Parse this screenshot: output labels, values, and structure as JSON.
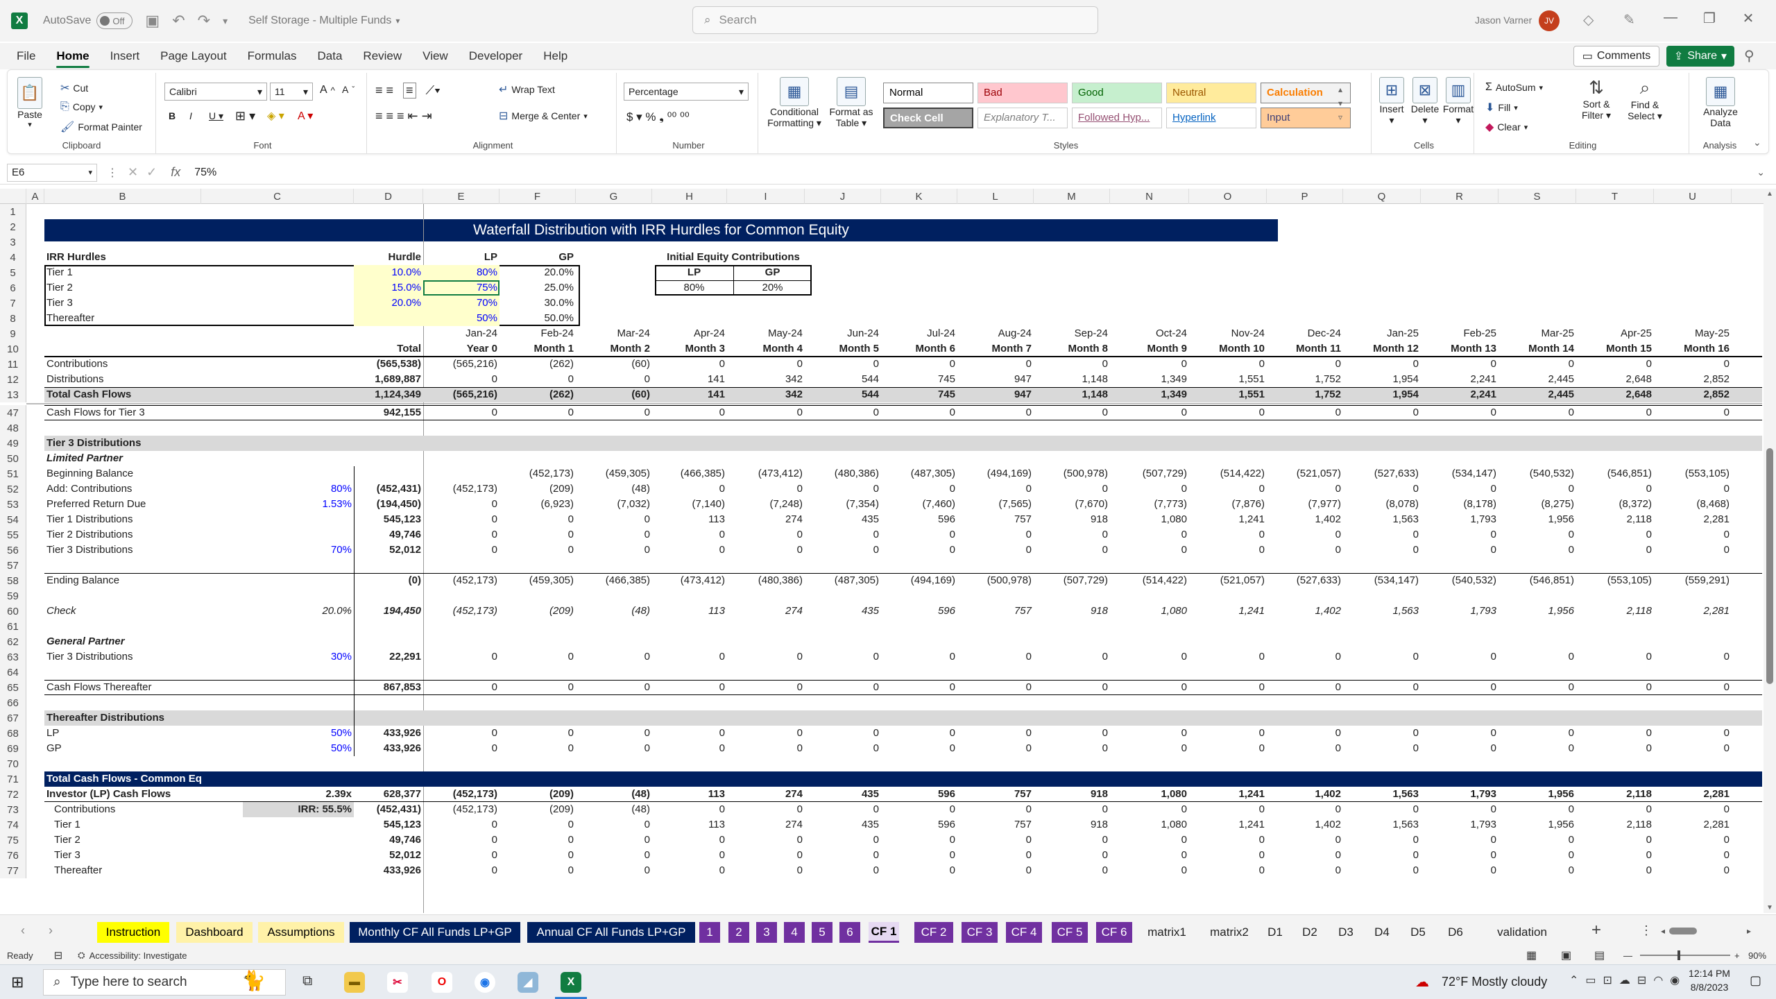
{
  "window": {
    "autosave": "AutoSave",
    "autosave_state": "Off",
    "filename": "Self Storage - Multiple Funds",
    "search_placeholder": "Search",
    "user": "Jason Varner",
    "user_initials": "JV"
  },
  "menu": [
    "File",
    "Home",
    "Insert",
    "Page Layout",
    "Formulas",
    "Data",
    "Review",
    "View",
    "Developer",
    "Help"
  ],
  "comments": "Comments",
  "share": "Share",
  "ribbon": {
    "paste": "Paste",
    "cut": "Cut",
    "copy": "Copy",
    "format_painter": "Format Painter",
    "clipboard": "Clipboard",
    "font_name": "Calibri",
    "font_size": "11",
    "font": "Font",
    "wrap_text": "Wrap Text",
    "merge_center": "Merge & Center",
    "alignment": "Alignment",
    "number_format": "Percentage",
    "number": "Number",
    "conditional": "Conditional",
    "formatting": "Formatting",
    "format_as": "Format as",
    "table": "Table",
    "styles": "Styles",
    "cells": "Cells",
    "insert": "Insert",
    "delete": "Delete",
    "format": "Format",
    "autosum": "AutoSum",
    "fill": "Fill",
    "clear": "Clear",
    "sort": "Sort &",
    "filter": "Filter",
    "find": "Find &",
    "select": "Select",
    "editing": "Editing",
    "analyze": "Analyze",
    "data_lbl": "Data",
    "analysis": "Analysis",
    "style_cells": [
      {
        "t": "Normal",
        "bg": "#ffffff",
        "fg": "#000000"
      },
      {
        "t": "Bad",
        "bg": "#ffc7ce",
        "fg": "#9c0006"
      },
      {
        "t": "Good",
        "bg": "#c6efce",
        "fg": "#006100"
      },
      {
        "t": "Neutral",
        "bg": "#ffeb9c",
        "fg": "#9c5700"
      },
      {
        "t": "Calculation",
        "bg": "#f2f2f2",
        "fg": "#fa7d00"
      },
      {
        "t": "Check Cell",
        "bg": "#a5a5a5",
        "fg": "#ffffff"
      },
      {
        "t": "Explanatory T...",
        "bg": "#ffffff",
        "fg": "#7f7f7f"
      },
      {
        "t": "Followed Hyp...",
        "bg": "#ffffff",
        "fg": "#954f72"
      },
      {
        "t": "Hyperlink",
        "bg": "#ffffff",
        "fg": "#0563c1"
      },
      {
        "t": "Input",
        "bg": "#ffcc99",
        "fg": "#3f3f76"
      }
    ]
  },
  "formula": {
    "cell_ref": "E6",
    "fx": "fx",
    "value": "75%"
  },
  "columns": [
    "A",
    "B",
    "C",
    "D",
    "E",
    "F",
    "G",
    "H",
    "I",
    "J",
    "K",
    "L",
    "M",
    "N",
    "O",
    "P",
    "Q",
    "R",
    "S",
    "T",
    "U"
  ],
  "title": "Waterfall Distribution with IRR Hurdles for Common Equity",
  "hurdles": {
    "title": "IRR Hurdles",
    "h_hurdle": "Hurdle",
    "h_lp": "LP",
    "h_gp": "GP",
    "rows": [
      [
        "Tier 1",
        "10.0%",
        "80%",
        "20.0%"
      ],
      [
        "Tier 2",
        "15.0%",
        "75%",
        "25.0%"
      ],
      [
        "Tier 3",
        "20.0%",
        "70%",
        "30.0%"
      ],
      [
        "Thereafter",
        "",
        "50%",
        "50.0%"
      ]
    ]
  },
  "initial_equity": {
    "title": "Initial Equity Contributions",
    "lp": "LP",
    "gp": "GP",
    "lp_val": "80%",
    "gp_val": "20%"
  },
  "dates": [
    "Jan-24",
    "Feb-24",
    "Mar-24",
    "Apr-24",
    "May-24",
    "Jun-24",
    "Jul-24",
    "Aug-24",
    "Sep-24",
    "Oct-24",
    "Nov-24",
    "Dec-24",
    "Jan-25",
    "Feb-25",
    "Mar-25",
    "Apr-25",
    "May-25"
  ],
  "periods": [
    "Year 0",
    "Month 1",
    "Month 2",
    "Month 3",
    "Month 4",
    "Month 5",
    "Month 6",
    "Month 7",
    "Month 8",
    "Month 9",
    "Month 10",
    "Month 11",
    "Month 12",
    "Month 13",
    "Month 14",
    "Month 15",
    "Month 16"
  ],
  "total_label": "Total",
  "rows": [
    {
      "n": "11",
      "b": "Contributions",
      "d": "(565,538)",
      "v": [
        "(565,216)",
        "(262)",
        "(60)",
        "0",
        "0",
        "0",
        "0",
        "0",
        "0",
        "0",
        "0",
        "0",
        "0",
        "0",
        "0",
        "0",
        "0"
      ]
    },
    {
      "n": "12",
      "b": "Distributions",
      "d": "1,689,887",
      "v": [
        "0",
        "0",
        "0",
        "141",
        "342",
        "544",
        "745",
        "947",
        "1,148",
        "1,349",
        "1,551",
        "1,752",
        "1,954",
        "2,241",
        "2,445",
        "2,648",
        "2,852"
      ]
    },
    {
      "n": "13",
      "b": "Total Cash Flows",
      "d": "1,124,349",
      "v": [
        "(565,216)",
        "(262)",
        "(60)",
        "141",
        "342",
        "544",
        "745",
        "947",
        "1,148",
        "1,349",
        "1,551",
        "1,752",
        "1,954",
        "2,241",
        "2,445",
        "2,648",
        "2,852"
      ]
    },
    {
      "n": "47",
      "b": "Cash Flows for Tier 3",
      "d": "942,155",
      "v": [
        "0",
        "0",
        "0",
        "0",
        "0",
        "0",
        "0",
        "0",
        "0",
        "0",
        "0",
        "0",
        "0",
        "0",
        "0",
        "0",
        "0"
      ]
    },
    {
      "n": "49",
      "b": "Tier 3 Distributions"
    },
    {
      "n": "50",
      "b": "Limited Partner"
    },
    {
      "n": "51",
      "b": "Beginning Balance",
      "v": [
        "",
        "(452,173)",
        "(459,305)",
        "(466,385)",
        "(473,412)",
        "(480,386)",
        "(487,305)",
        "(494,169)",
        "(500,978)",
        "(507,729)",
        "(514,422)",
        "(521,057)",
        "(527,633)",
        "(534,147)",
        "(540,532)",
        "(546,851)",
        "(553,105)"
      ]
    },
    {
      "n": "52",
      "b": "Add: Contributions",
      "c": "80%",
      "d": "(452,431)",
      "v": [
        "(452,173)",
        "(209)",
        "(48)",
        "0",
        "0",
        "0",
        "0",
        "0",
        "0",
        "0",
        "0",
        "0",
        "0",
        "0",
        "0",
        "0",
        "0"
      ]
    },
    {
      "n": "53",
      "b": "Preferred Return Due",
      "c": "1.53%",
      "d": "(194,450)",
      "v": [
        "0",
        "(6,923)",
        "(7,032)",
        "(7,140)",
        "(7,248)",
        "(7,354)",
        "(7,460)",
        "(7,565)",
        "(7,670)",
        "(7,773)",
        "(7,876)",
        "(7,977)",
        "(8,078)",
        "(8,178)",
        "(8,275)",
        "(8,372)",
        "(8,468)"
      ]
    },
    {
      "n": "54",
      "b": "Tier 1 Distributions",
      "d": "545,123",
      "v": [
        "0",
        "0",
        "0",
        "113",
        "274",
        "435",
        "596",
        "757",
        "918",
        "1,080",
        "1,241",
        "1,402",
        "1,563",
        "1,793",
        "1,956",
        "2,118",
        "2,281"
      ]
    },
    {
      "n": "55",
      "b": "Tier 2 Distributions",
      "d": "49,746",
      "v": [
        "0",
        "0",
        "0",
        "0",
        "0",
        "0",
        "0",
        "0",
        "0",
        "0",
        "0",
        "0",
        "0",
        "0",
        "0",
        "0",
        "0"
      ]
    },
    {
      "n": "56",
      "b": "Tier 3 Distributions",
      "c": "70%",
      "d": "52,012",
      "v": [
        "0",
        "0",
        "0",
        "0",
        "0",
        "0",
        "0",
        "0",
        "0",
        "0",
        "0",
        "0",
        "0",
        "0",
        "0",
        "0",
        "0"
      ]
    },
    {
      "n": "57"
    },
    {
      "n": "58",
      "b": "Ending Balance",
      "d": "(0)",
      "v": [
        "(452,173)",
        "(459,305)",
        "(466,385)",
        "(473,412)",
        "(480,386)",
        "(487,305)",
        "(494,169)",
        "(500,978)",
        "(507,729)",
        "(514,422)",
        "(521,057)",
        "(527,633)",
        "(534,147)",
        "(540,532)",
        "(546,851)",
        "(553,105)",
        "(559,291)"
      ]
    },
    {
      "n": "59"
    },
    {
      "n": "60",
      "b": "Check",
      "c": "20.0%",
      "d": "194,450",
      "v": [
        "(452,173)",
        "(209)",
        "(48)",
        "113",
        "274",
        "435",
        "596",
        "757",
        "918",
        "1,080",
        "1,241",
        "1,402",
        "1,563",
        "1,793",
        "1,956",
        "2,118",
        "2,281"
      ]
    },
    {
      "n": "61"
    },
    {
      "n": "62",
      "b": "General Partner"
    },
    {
      "n": "63",
      "b": "Tier 3 Distributions",
      "c": "30%",
      "d": "22,291",
      "v": [
        "0",
        "0",
        "0",
        "0",
        "0",
        "0",
        "0",
        "0",
        "0",
        "0",
        "0",
        "0",
        "0",
        "0",
        "0",
        "0",
        "0"
      ]
    },
    {
      "n": "64"
    },
    {
      "n": "65",
      "b": "Cash Flows Thereafter",
      "d": "867,853",
      "v": [
        "0",
        "0",
        "0",
        "0",
        "0",
        "0",
        "0",
        "0",
        "0",
        "0",
        "0",
        "0",
        "0",
        "0",
        "0",
        "0",
        "0"
      ]
    },
    {
      "n": "66"
    },
    {
      "n": "67",
      "b": "Thereafter Distributions"
    },
    {
      "n": "68",
      "b": "LP",
      "c": "50%",
      "d": "433,926",
      "v": [
        "0",
        "0",
        "0",
        "0",
        "0",
        "0",
        "0",
        "0",
        "0",
        "0",
        "0",
        "0",
        "0",
        "0",
        "0",
        "0",
        "0"
      ]
    },
    {
      "n": "69",
      "b": "GP",
      "c": "50%",
      "d": "433,926",
      "v": [
        "0",
        "0",
        "0",
        "0",
        "0",
        "0",
        "0",
        "0",
        "0",
        "0",
        "0",
        "0",
        "0",
        "0",
        "0",
        "0",
        "0"
      ]
    },
    {
      "n": "70"
    },
    {
      "n": "71",
      "b": "Total Cash Flows - Common Equity"
    },
    {
      "n": "72",
      "b": "Investor (LP) Cash Flows",
      "c": "2.39x",
      "d": "628,377",
      "v": [
        "(452,173)",
        "(209)",
        "(48)",
        "113",
        "274",
        "435",
        "596",
        "757",
        "918",
        "1,080",
        "1,241",
        "1,402",
        "1,563",
        "1,793",
        "1,956",
        "2,118",
        "2,281"
      ]
    },
    {
      "n": "73",
      "b": "Contributions",
      "c": "IRR: 55.5%",
      "d": "(452,431)",
      "v": [
        "(452,173)",
        "(209)",
        "(48)",
        "0",
        "0",
        "0",
        "0",
        "0",
        "0",
        "0",
        "0",
        "0",
        "0",
        "0",
        "0",
        "0",
        "0"
      ]
    },
    {
      "n": "74",
      "b": "Tier 1",
      "d": "545,123",
      "v": [
        "0",
        "0",
        "0",
        "113",
        "274",
        "435",
        "596",
        "757",
        "918",
        "1,080",
        "1,241",
        "1,402",
        "1,563",
        "1,793",
        "1,956",
        "2,118",
        "2,281"
      ]
    },
    {
      "n": "75",
      "b": "Tier 2",
      "d": "49,746",
      "v": [
        "0",
        "0",
        "0",
        "0",
        "0",
        "0",
        "0",
        "0",
        "0",
        "0",
        "0",
        "0",
        "0",
        "0",
        "0",
        "0",
        "0"
      ]
    },
    {
      "n": "76",
      "b": "Tier 3",
      "d": "52,012",
      "v": [
        "0",
        "0",
        "0",
        "0",
        "0",
        "0",
        "0",
        "0",
        "0",
        "0",
        "0",
        "0",
        "0",
        "0",
        "0",
        "0",
        "0"
      ]
    },
    {
      "n": "77",
      "b": "Thereafter",
      "d": "433,926",
      "v": [
        "0",
        "0",
        "0",
        "0",
        "0",
        "0",
        "0",
        "0",
        "0",
        "0",
        "0",
        "0",
        "0",
        "0",
        "0",
        "0",
        "0"
      ]
    }
  ],
  "sheet_tabs": [
    {
      "t": "Instruction",
      "bg": "#ffff00",
      "fg": "#000"
    },
    {
      "t": "Dashboard",
      "bg": "#fff2a8",
      "fg": "#000"
    },
    {
      "t": "Assumptions",
      "bg": "#fff2a8",
      "fg": "#000"
    },
    {
      "t": "Monthly CF All Funds LP+GP",
      "bg": "#002060",
      "fg": "#fff"
    },
    {
      "t": "Annual CF All Funds LP+GP",
      "bg": "#002060",
      "fg": "#fff"
    },
    {
      "t": "1",
      "bg": "#7030a0",
      "fg": "#fff"
    },
    {
      "t": "2",
      "bg": "#7030a0",
      "fg": "#fff"
    },
    {
      "t": "3",
      "bg": "#7030a0",
      "fg": "#fff"
    },
    {
      "t": "4",
      "bg": "#7030a0",
      "fg": "#fff"
    },
    {
      "t": "5",
      "bg": "#7030a0",
      "fg": "#fff"
    },
    {
      "t": "6",
      "bg": "#7030a0",
      "fg": "#fff"
    },
    {
      "t": "CF 1",
      "bg": "#e6d9f2",
      "fg": "#000"
    },
    {
      "t": "CF 2",
      "bg": "#7030a0",
      "fg": "#fff"
    },
    {
      "t": "CF 3",
      "bg": "#7030a0",
      "fg": "#fff"
    },
    {
      "t": "CF 4",
      "bg": "#7030a0",
      "fg": "#fff"
    },
    {
      "t": "CF 5",
      "bg": "#7030a0",
      "fg": "#fff"
    },
    {
      "t": "CF 6",
      "bg": "#7030a0",
      "fg": "#fff"
    },
    {
      "t": "matrix1",
      "bg": "transparent",
      "fg": "#222"
    },
    {
      "t": "matrix2",
      "bg": "transparent",
      "fg": "#222"
    },
    {
      "t": "D1",
      "bg": "transparent",
      "fg": "#222"
    },
    {
      "t": "D2",
      "bg": "transparent",
      "fg": "#222"
    },
    {
      "t": "D3",
      "bg": "transparent",
      "fg": "#222"
    },
    {
      "t": "D4",
      "bg": "transparent",
      "fg": "#222"
    },
    {
      "t": "D5",
      "bg": "transparent",
      "fg": "#222"
    },
    {
      "t": "D6",
      "bg": "transparent",
      "fg": "#222"
    },
    {
      "t": "validation",
      "bg": "transparent",
      "fg": "#222"
    }
  ],
  "status": {
    "ready": "Ready",
    "accessibility": "Accessibility: Investigate",
    "zoom": "90%"
  },
  "taskbar": {
    "search": "Type here to search",
    "weather": "72°F  Mostly cloudy",
    "time": "12:14 PM",
    "date": "8/8/2023"
  }
}
